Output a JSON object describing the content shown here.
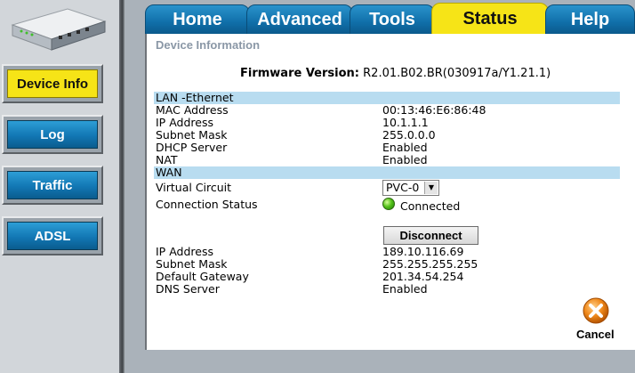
{
  "tabs": [
    {
      "label": "Home"
    },
    {
      "label": "Advanced"
    },
    {
      "label": "Tools"
    },
    {
      "label": "Status",
      "active": true
    },
    {
      "label": "Help"
    }
  ],
  "sidebar": {
    "items": [
      {
        "label": "Device Info",
        "active": true
      },
      {
        "label": "Log"
      },
      {
        "label": "Traffic"
      },
      {
        "label": "ADSL"
      }
    ]
  },
  "content": {
    "section_title": "Device Information",
    "firmware_label": "Firmware Version:",
    "firmware_value": "R2.01.B02.BR(030917a/Y1.21.1)",
    "lan_header": "LAN -Ethernet",
    "lan": [
      {
        "label": "MAC Address",
        "value": "00:13:46:E6:86:48"
      },
      {
        "label": "IP Address",
        "value": "10.1.1.1"
      },
      {
        "label": "Subnet Mask",
        "value": "255.0.0.0"
      },
      {
        "label": "DHCP Server",
        "value": "Enabled"
      },
      {
        "label": "NAT",
        "value": "Enabled"
      }
    ],
    "wan_header": "WAN",
    "virtual_circuit_label": "Virtual Circuit",
    "virtual_circuit_value": "PVC-0",
    "connection_status_label": "Connection Status",
    "connection_status_value": "Connected",
    "disconnect_label": "Disconnect",
    "wan": [
      {
        "label": "IP Address",
        "value": "189.10.116.69"
      },
      {
        "label": "Subnet Mask",
        "value": "255.255.255.255"
      },
      {
        "label": "Default Gateway",
        "value": "201.34.54.254"
      },
      {
        "label": "DNS Server",
        "value": "Enabled"
      }
    ],
    "cancel_label": "Cancel"
  },
  "colors": {
    "tab_blue": "#106fa9",
    "active_yellow": "#f6e417",
    "band_blue": "#b8dcf0",
    "status_green": "#55c21a",
    "cancel_orange": "#f08a1c"
  }
}
